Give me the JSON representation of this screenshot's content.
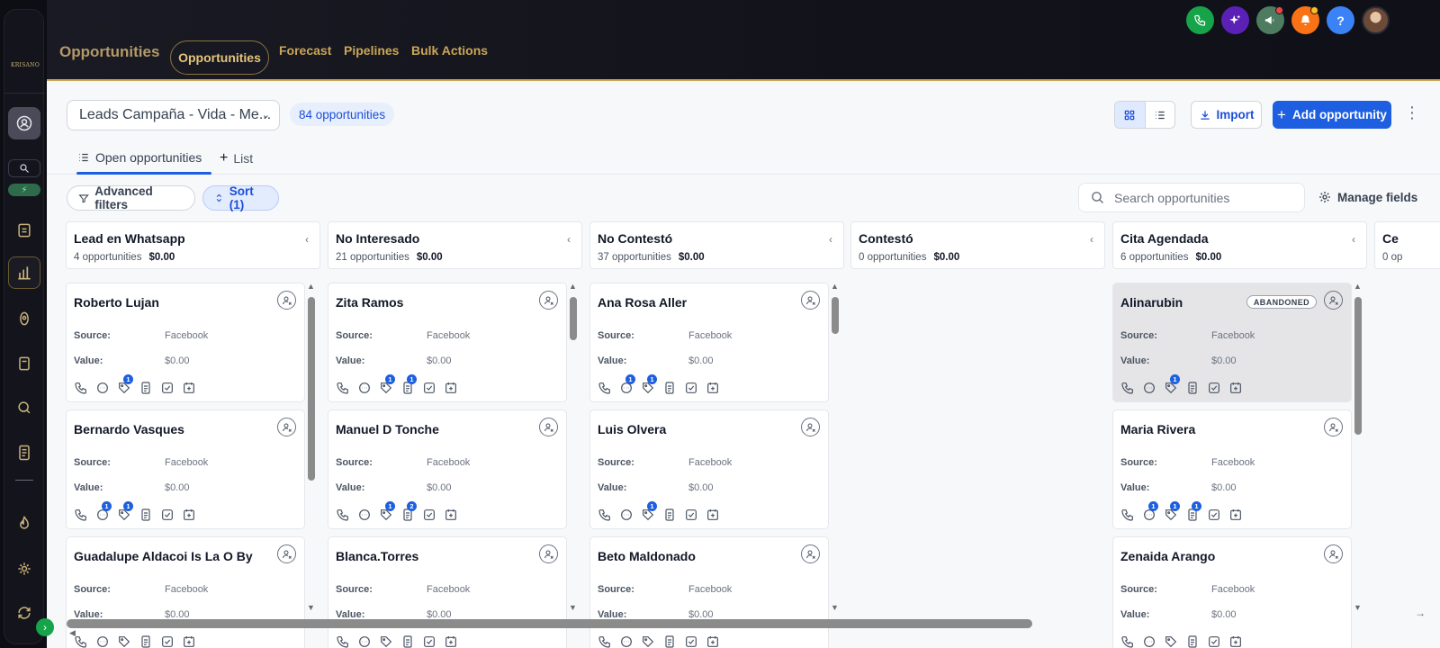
{
  "app": {
    "logo_text": "KRISANO",
    "page_title": "Opportunities",
    "top_tabs": [
      "Opportunities",
      "Forecast",
      "Pipelines",
      "Bulk Actions"
    ],
    "header_icon_colors": {
      "phone": "#16a34a",
      "ai": "#5b21b6",
      "megaphone": "#4d7c60",
      "bell": "#f97316",
      "help": "#3b82f6"
    }
  },
  "toolbar": {
    "pipeline": "Leads Campaña - Vida - Me...",
    "count": "84 opportunities",
    "import_label": "Import",
    "add_label": "Add opportunity"
  },
  "subtabs": {
    "open": "Open opportunities",
    "list": "List"
  },
  "filters": {
    "advanced": "Advanced filters",
    "sort": "Sort (1)",
    "search_placeholder": "Search opportunities",
    "manage_fields": "Manage fields"
  },
  "labels": {
    "source": "Source:",
    "value": "Value:",
    "abandoned": "ABANDONED"
  },
  "columns": [
    {
      "title": "Lead en Whatsapp",
      "count": "4 opportunities",
      "total": "$0.00",
      "cards": [
        {
          "name": "Roberto Lujan",
          "source": "Facebook",
          "value": "$0.00",
          "badges": [
            "",
            "",
            "1",
            "",
            "",
            ""
          ]
        },
        {
          "name": "Bernardo Vasques",
          "source": "Facebook",
          "value": "$0.00",
          "badges": [
            "",
            "1",
            "1",
            "",
            "",
            ""
          ]
        },
        {
          "name": "Guadalupe Aldacoi Is La O By",
          "source": "Facebook",
          "value": "$0.00",
          "badges": [
            "",
            "",
            "",
            "",
            "",
            ""
          ]
        }
      ]
    },
    {
      "title": "No Interesado",
      "count": "21 opportunities",
      "total": "$0.00",
      "cards": [
        {
          "name": "Zita Ramos",
          "source": "Facebook",
          "value": "$0.00",
          "badges": [
            "",
            "",
            "1",
            "1",
            "",
            ""
          ]
        },
        {
          "name": "Manuel D Tonche",
          "source": "Facebook",
          "value": "$0.00",
          "badges": [
            "",
            "",
            "1",
            "2",
            "",
            ""
          ]
        },
        {
          "name": "Blanca.Torres",
          "source": "Facebook",
          "value": "$0.00",
          "badges": [
            "",
            "",
            "",
            "",
            "",
            ""
          ]
        }
      ]
    },
    {
      "title": "No Contestó",
      "count": "37 opportunities",
      "total": "$0.00",
      "cards": [
        {
          "name": "Ana Rosa Aller",
          "source": "Facebook",
          "value": "$0.00",
          "badges": [
            "",
            "1",
            "1",
            "",
            "",
            ""
          ]
        },
        {
          "name": "Luis Olvera",
          "source": "Facebook",
          "value": "$0.00",
          "badges": [
            "",
            "",
            "1",
            "",
            "",
            ""
          ]
        },
        {
          "name": "Beto Maldonado",
          "source": "Facebook",
          "value": "$0.00",
          "badges": [
            "",
            "",
            "",
            "",
            "",
            ""
          ]
        }
      ]
    },
    {
      "title": "Contestó",
      "count": "0 opportunities",
      "total": "$0.00",
      "cards": []
    },
    {
      "title": "Cita Agendada",
      "count": "6 opportunities",
      "total": "$0.00",
      "cards": [
        {
          "name": "Alinarubin",
          "source": "Facebook",
          "value": "$0.00",
          "abandoned": true,
          "badges": [
            "",
            "",
            "1",
            "",
            "",
            ""
          ]
        },
        {
          "name": "Maria Rivera",
          "source": "Facebook",
          "value": "$0.00",
          "badges": [
            "",
            "1",
            "1",
            "1",
            "",
            ""
          ]
        },
        {
          "name": "Zenaida Arango",
          "source": "Facebook",
          "value": "$0.00",
          "badges": [
            "",
            "",
            "",
            "",
            "",
            ""
          ]
        }
      ]
    },
    {
      "title": "Ce",
      "count": "0 op",
      "total": "",
      "cards": []
    }
  ],
  "column_scroll": [
    {
      "column": 0,
      "scroll_fraction": 0.0,
      "visible_fraction": 0.6
    },
    {
      "column": 1,
      "scroll_fraction": 0.0,
      "visible_fraction": 0.14
    },
    {
      "column": 2,
      "scroll_fraction": 0.0,
      "visible_fraction": 0.12
    },
    {
      "column": 4,
      "scroll_fraction": 0.0,
      "visible_fraction": 0.45
    }
  ],
  "board_scroll": {
    "scroll_fraction": 0.0,
    "visible_fraction": 0.72
  }
}
